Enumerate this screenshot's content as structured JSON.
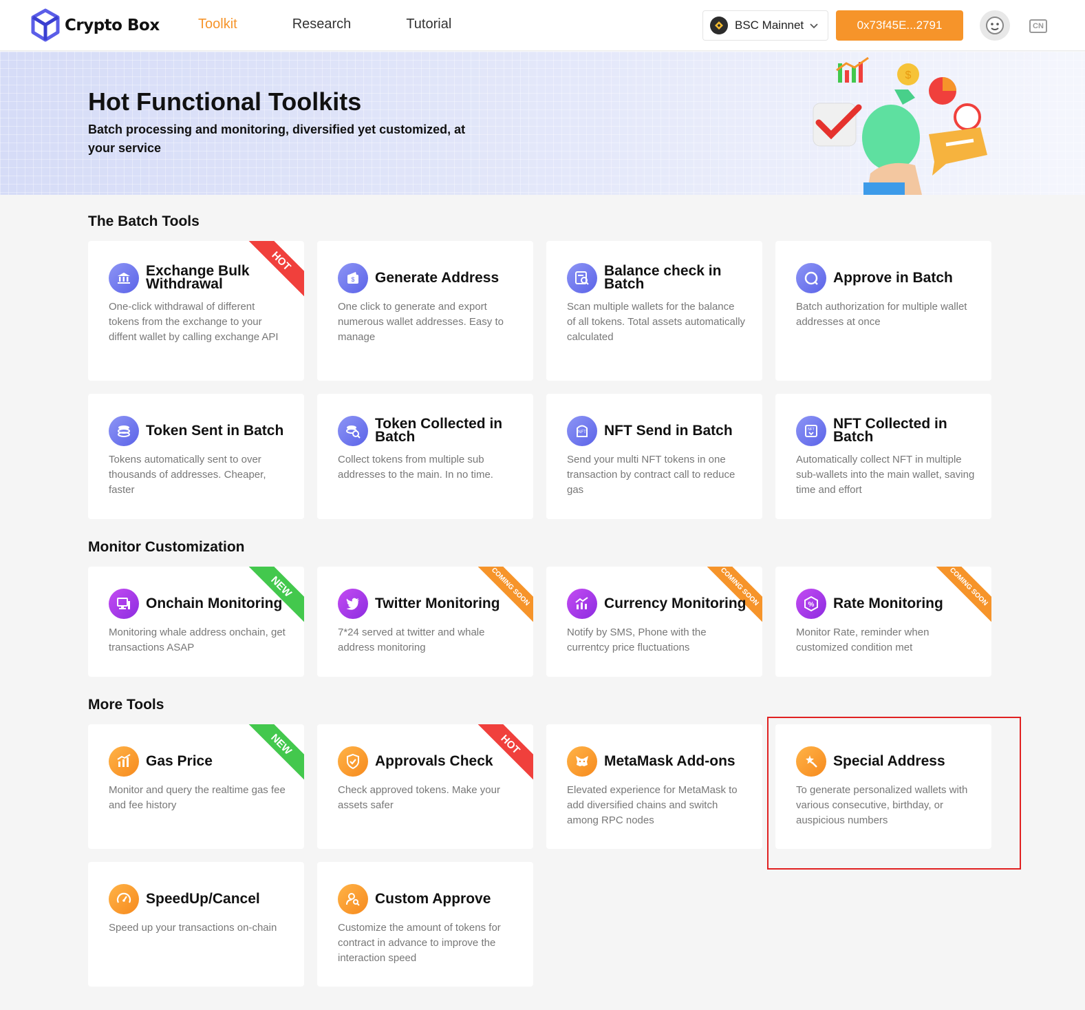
{
  "header": {
    "logo_text": "Crypto Box",
    "nav": [
      {
        "label": "Toolkit",
        "active": true
      },
      {
        "label": "Research",
        "active": false
      },
      {
        "label": "Tutorial",
        "active": false
      }
    ],
    "network": {
      "label": "BSC Mainnet",
      "icon": "bnb-icon"
    },
    "wallet_address": "0x73f45E...2791",
    "language": "CN"
  },
  "banner": {
    "title": "Hot Functional Toolkits",
    "subtitle": "Batch processing and monitoring, diversified yet customized, at your service"
  },
  "sections": {
    "batch": {
      "title": "The Batch Tools",
      "cards": [
        {
          "title": "Exchange Bulk Withdrawal",
          "desc": "One-click withdrawal of different tokens from the exchange to your diffent wallet by calling exchange API",
          "badge": "HOT",
          "icon": "bank-icon"
        },
        {
          "title": "Generate Address",
          "desc": "One click to generate and export numerous wallet addresses. Easy to manage",
          "badge": "",
          "icon": "wallet-icon"
        },
        {
          "title": "Balance check in Batch",
          "desc": "Scan multiple wallets for the balance of all tokens. Total assets automatically calculated",
          "badge": "",
          "icon": "balance-search-icon"
        },
        {
          "title": "Approve in Batch",
          "desc": "Batch authorization for multiple wallet addresses at once",
          "badge": "",
          "icon": "approve-icon"
        },
        {
          "title": "Token Sent in Batch",
          "desc": "Tokens automatically sent to over thousands of addresses. Cheaper, faster",
          "badge": "",
          "icon": "coins-icon"
        },
        {
          "title": "Token Collected in Batch",
          "desc": "Collect tokens from multiple sub addresses to the main. In no time.",
          "badge": "",
          "icon": "coin-search-icon"
        },
        {
          "title": "NFT Send in Batch",
          "desc": "Send your multi NFT tokens in one transaction by contract call to reduce gas",
          "badge": "",
          "icon": "nft-send-icon"
        },
        {
          "title": "NFT Collected in Batch",
          "desc": "Automatically collect NFT in multiple sub-wallets into the main wallet, saving time and effort",
          "badge": "",
          "icon": "nft-collect-icon"
        }
      ]
    },
    "monitor": {
      "title": "Monitor Customization",
      "cards": [
        {
          "title": "Onchain Monitoring",
          "desc": "Monitoring whale address onchain, get transactions ASAP",
          "badge": "NEW",
          "icon": "monitor-icon"
        },
        {
          "title": "Twitter Monitoring",
          "desc": "7*24 served at twitter and whale address monitoring",
          "badge": "COMING SOON",
          "icon": "twitter-icon"
        },
        {
          "title": "Currency Monitoring",
          "desc": "Notify by SMS, Phone with the currentcy price fluctuations",
          "badge": "COMING SOON",
          "icon": "chart-icon"
        },
        {
          "title": "Rate Monitoring",
          "desc": "Monitor Rate, reminder when customized condition met",
          "badge": "COMING SOON",
          "icon": "rate-icon"
        }
      ]
    },
    "more": {
      "title": "More Tools",
      "cards": [
        {
          "title": "Gas Price",
          "desc": "Monitor and query the realtime gas fee and fee history",
          "badge": "NEW",
          "icon": "gas-chart-icon"
        },
        {
          "title": "Approvals Check",
          "desc": "Check approved tokens. Make your assets safer",
          "badge": "HOT",
          "icon": "shield-check-icon"
        },
        {
          "title": "MetaMask Add-ons",
          "desc": "Elevated experience for MetaMask to add diversified chains and switch among RPC nodes",
          "badge": "",
          "icon": "metamask-icon"
        },
        {
          "title": "Special Address",
          "desc": "To generate personalized wallets with various consecutive, birthday, or auspicious numbers",
          "badge": "",
          "icon": "magic-wand-icon"
        },
        {
          "title": "SpeedUp/Cancel",
          "desc": "Speed up your transactions on-chain",
          "badge": "",
          "icon": "speedometer-icon"
        },
        {
          "title": "Custom Approve",
          "desc": "Customize the amount of tokens for contract in advance to improve the interaction speed",
          "badge": "",
          "icon": "user-key-icon"
        }
      ]
    }
  },
  "colors": {
    "accent": "#f6942a",
    "hot": "#f0403c",
    "new": "#43c84d",
    "highlight_box": "#e02020"
  }
}
